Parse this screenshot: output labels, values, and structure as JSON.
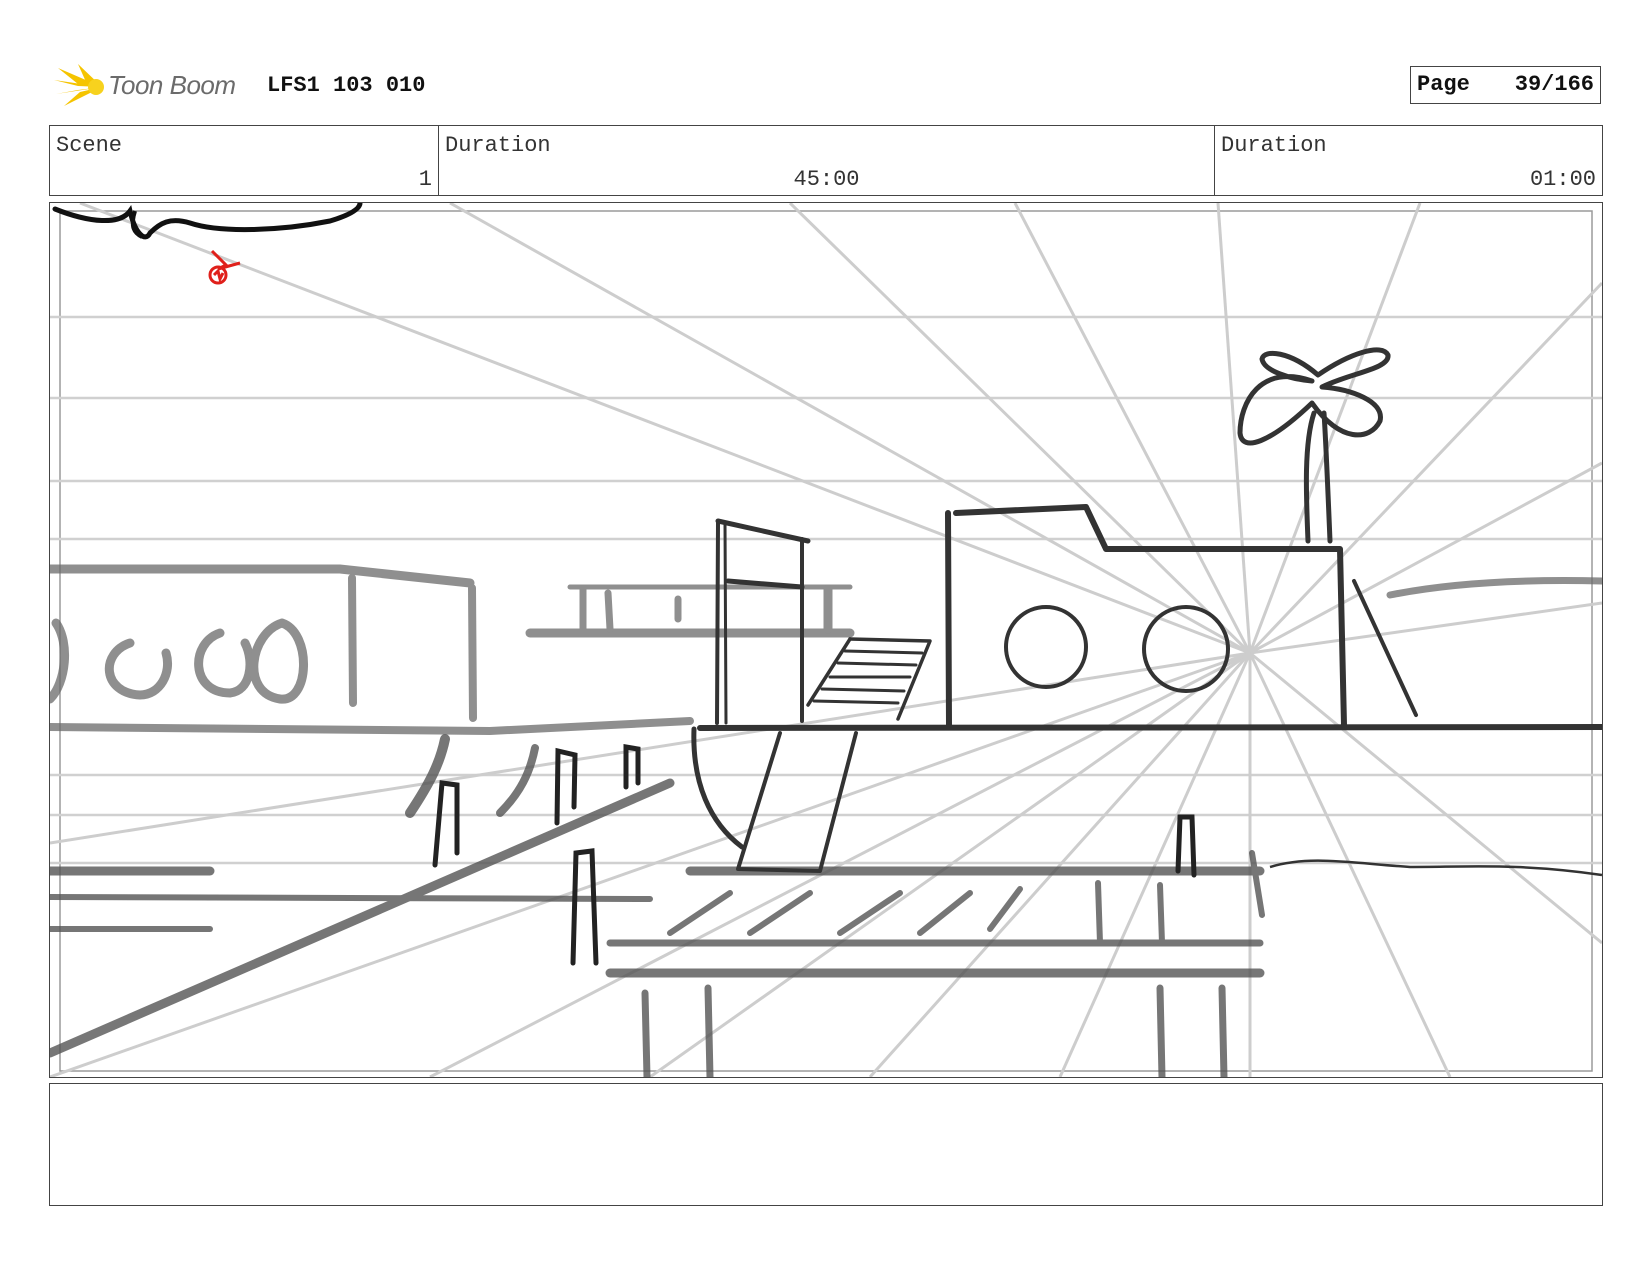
{
  "header": {
    "logo_text": "Toon Boom",
    "project_id": "LFS1 103 010",
    "page_label": "Page",
    "page_value": "39/166"
  },
  "info": {
    "scene_label": "Scene",
    "scene_value": "1",
    "duration1_label": "Duration",
    "duration1_value": "45:00",
    "duration2_label": "Duration",
    "duration2_value": "01:00"
  },
  "colors": {
    "border": "#444444",
    "guide_lines": "#cfcfcf",
    "sketch_dark": "#333333",
    "sketch_mid": "#777777",
    "annotation_red": "#e0201b",
    "logo_yellow": "#f5c400"
  }
}
